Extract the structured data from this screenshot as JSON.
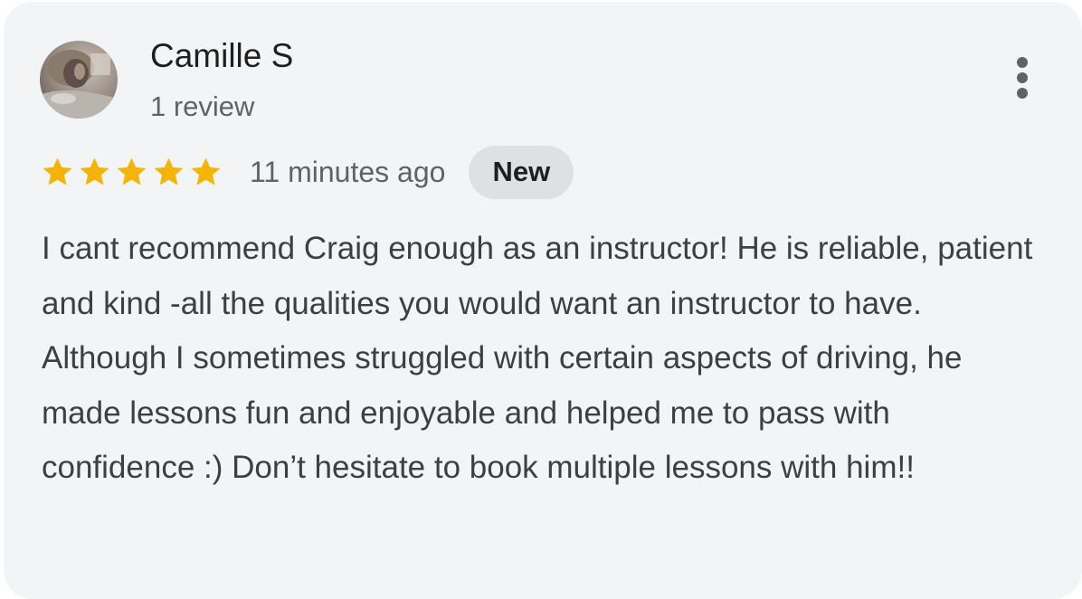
{
  "review": {
    "reviewer_name": "Camille S",
    "review_count": "1 review",
    "rating": 5,
    "max_rating": 5,
    "time_ago": "11 minutes ago",
    "badge": "New",
    "text": "I cant recommend Craig enough as an instructor! He is reliable, patient and kind -all the qualities you would want an instructor to have. Although I sometimes struggled with certain aspects of driving, he made lessons fun and enjoyable and helped me to pass with confidence :) Don’t hesitate to book multiple lessons with him!!"
  },
  "icons": {
    "star": "star-icon",
    "more": "more-vert-icon",
    "avatar": "avatar"
  },
  "colors": {
    "star": "#f4b400",
    "card_background": "#f3f4f6",
    "badge_background": "#dfe0e2"
  }
}
